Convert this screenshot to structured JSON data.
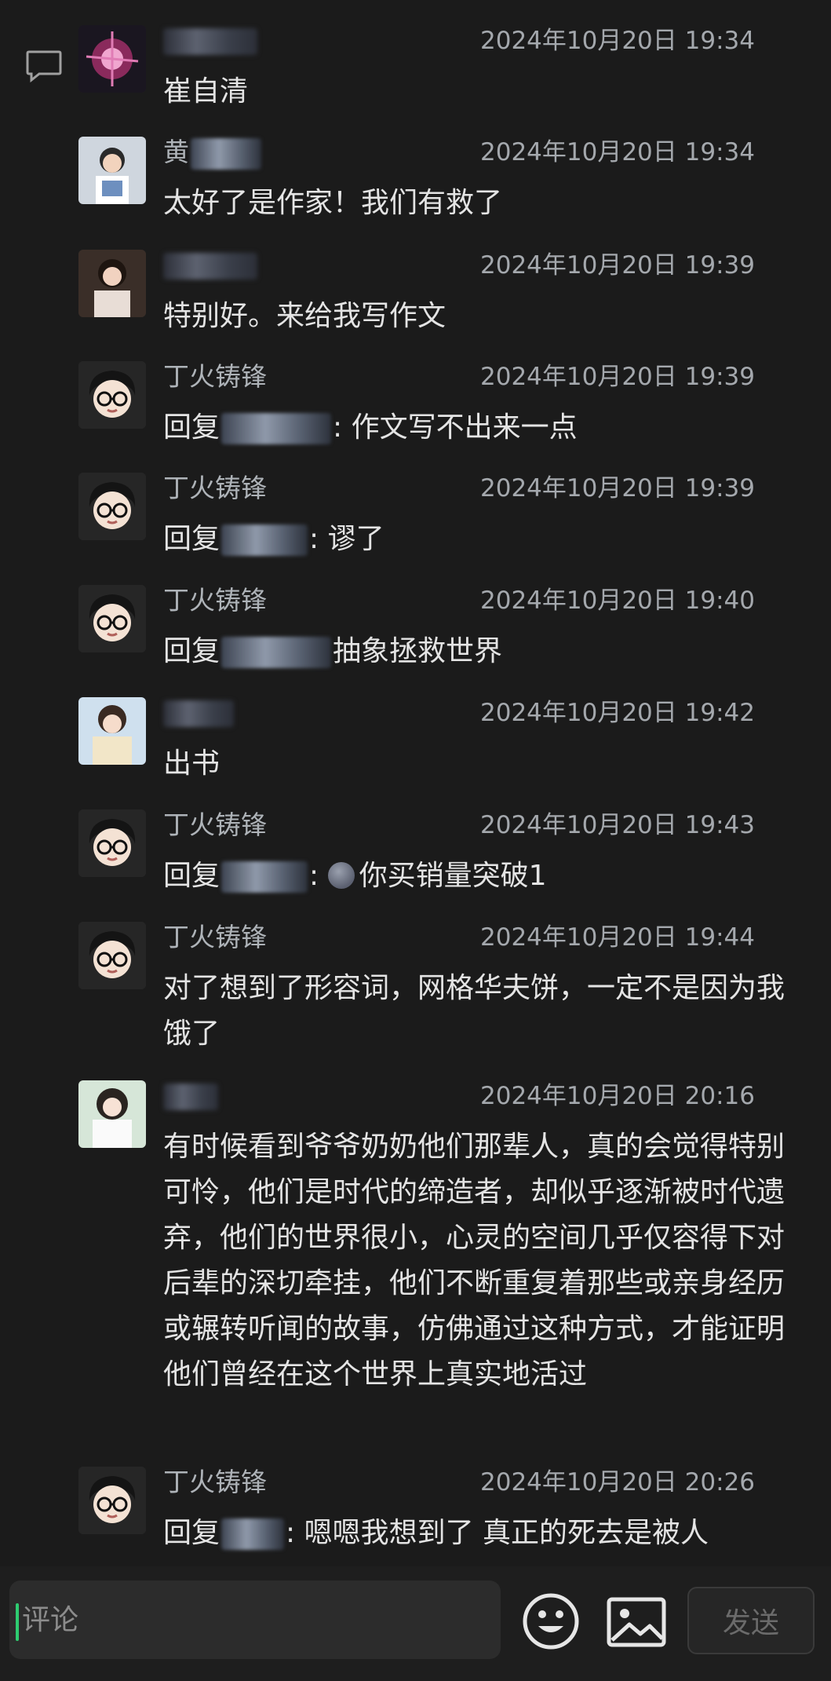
{
  "input": {
    "placeholder": "评论"
  },
  "send_label": "发送",
  "colors": {
    "background": "#1b1b1b",
    "caret": "#2ecc71",
    "time": "#a4a8ad",
    "text": "#e4e4e4"
  },
  "comments": [
    {
      "name": "",
      "time": "2024年10月20日 19:34",
      "text": "崔自清"
    },
    {
      "name": "黄",
      "time": "2024年10月20日 19:34",
      "text": "太好了是作家！我们有救了"
    },
    {
      "name": "",
      "time": "2024年10月20日 19:39",
      "text": "特别好。来给我写作文"
    },
    {
      "name": "丁火铸锋",
      "time": "2024年10月20日 19:39",
      "reply_prefix": "回复",
      "reply_suffix": ": 作文写不出来一点"
    },
    {
      "name": "丁火铸锋",
      "time": "2024年10月20日 19:39",
      "reply_prefix": "回复",
      "reply_suffix": ": 谬了"
    },
    {
      "name": "丁火铸锋",
      "time": "2024年10月20日 19:40",
      "reply_prefix": "回复",
      "reply_suffix": "抽象拯救世界"
    },
    {
      "name": "",
      "time": "2024年10月20日 19:42",
      "text": "出书"
    },
    {
      "name": "丁火铸锋",
      "time": "2024年10月20日 19:43",
      "reply_prefix": "回复",
      "reply_suffix": "你买销量突破1"
    },
    {
      "name": "丁火铸锋",
      "time": "2024年10月20日 19:44",
      "text": "对了想到了形容词，网格华夫饼，一定不是因为我饿了"
    },
    {
      "name": "",
      "time": "2024年10月20日 20:16",
      "text": "有时候看到爷爷奶奶他们那辈人，真的会觉得特别可怜，他们是时代的缔造者，却似乎逐渐被时代遗弃，他们的世界很小，心灵的空间几乎仅容得下对后辈的深切牵挂，他们不断重复着那些或亲身经历或辗转听闻的故事，仿佛通过这种方式，才能证明他们曾经在这个世界上真实地活过"
    },
    {
      "name": "丁火铸锋",
      "time": "2024年10月20日 20:26",
      "reply_prefix": "回复",
      "reply_suffix": ": 嗯嗯我想到了 真正的死去是被人"
    }
  ]
}
